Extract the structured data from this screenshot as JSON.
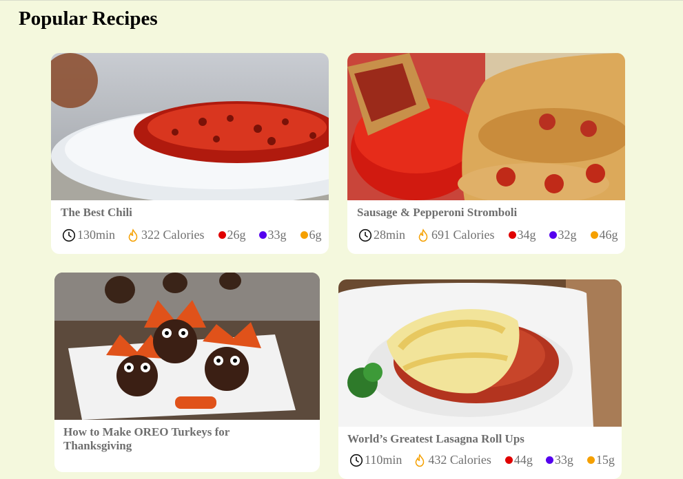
{
  "page": {
    "title": "Popular Recipes"
  },
  "colors": {
    "background": "#f4f8dd",
    "protein": "#e00000",
    "carbs": "#5500ee",
    "fat": "#f5a000"
  },
  "icons": {
    "time": "clock-icon",
    "calories": "flame-icon"
  },
  "recipes": [
    {
      "title": "The Best Chili",
      "time": "130min",
      "calories": "322 Calories",
      "protein": "26g",
      "carbs": "33g",
      "fat": "6g"
    },
    {
      "title": "Sausage & Pepperoni Stromboli",
      "time": "28min",
      "calories": "691 Calories",
      "protein": "34g",
      "carbs": "32g",
      "fat": "46g"
    },
    {
      "title": "How to Make OREO Turkeys for Thanksgiving"
    },
    {
      "title": "World’s Greatest Lasagna Roll Ups",
      "time": "110min",
      "calories": "432 Calories",
      "protein": "44g",
      "carbs": "33g",
      "fat": "15g"
    }
  ]
}
